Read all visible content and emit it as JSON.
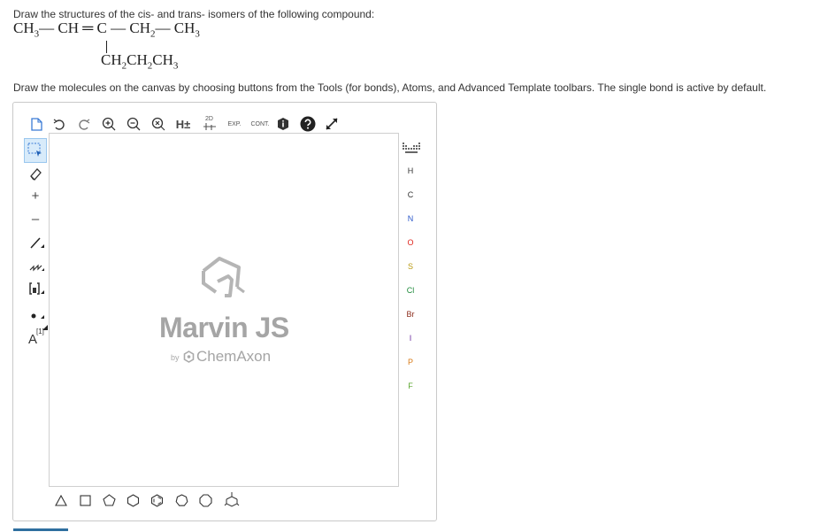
{
  "question": {
    "prompt": "Draw the structures of the cis- and trans- isomers of the following compound:",
    "formula_main": [
      "CH",
      "3",
      "— CH ═ C — CH",
      "2",
      "— CH",
      "3"
    ],
    "formula_branch": [
      "CH",
      "2",
      "CH",
      "2",
      "CH",
      "3"
    ],
    "instructions": "Draw the molecules on the canvas by choosing buttons from the Tools (for bonds), Atoms, and Advanced Template toolbars. The single bond is active by default."
  },
  "editor": {
    "top_toolbar": {
      "hplus_label": "H±",
      "label_2d": "2D",
      "exp_label": "EXP.",
      "cont_label": "CONT."
    },
    "left_toolbar": {
      "charge_plus": "+",
      "charge_minus": "–",
      "atom_map_label": "[1]",
      "atom_map_letter": "A"
    },
    "atoms": [
      "H",
      "C",
      "N",
      "O",
      "S",
      "Cl",
      "Br",
      "I",
      "P",
      "F"
    ],
    "atom_colors": {
      "H": "#333333",
      "C": "#333333",
      "N": "#2b57c9",
      "O": "#e0261e",
      "S": "#b99a12",
      "Cl": "#1d8a3a",
      "Br": "#8b2a1a",
      "I": "#6a2d9e",
      "P": "#d87a16",
      "F": "#5aa62d"
    },
    "brand": {
      "name": "Marvin JS",
      "by": "by",
      "vendor": "ChemAxon"
    }
  }
}
